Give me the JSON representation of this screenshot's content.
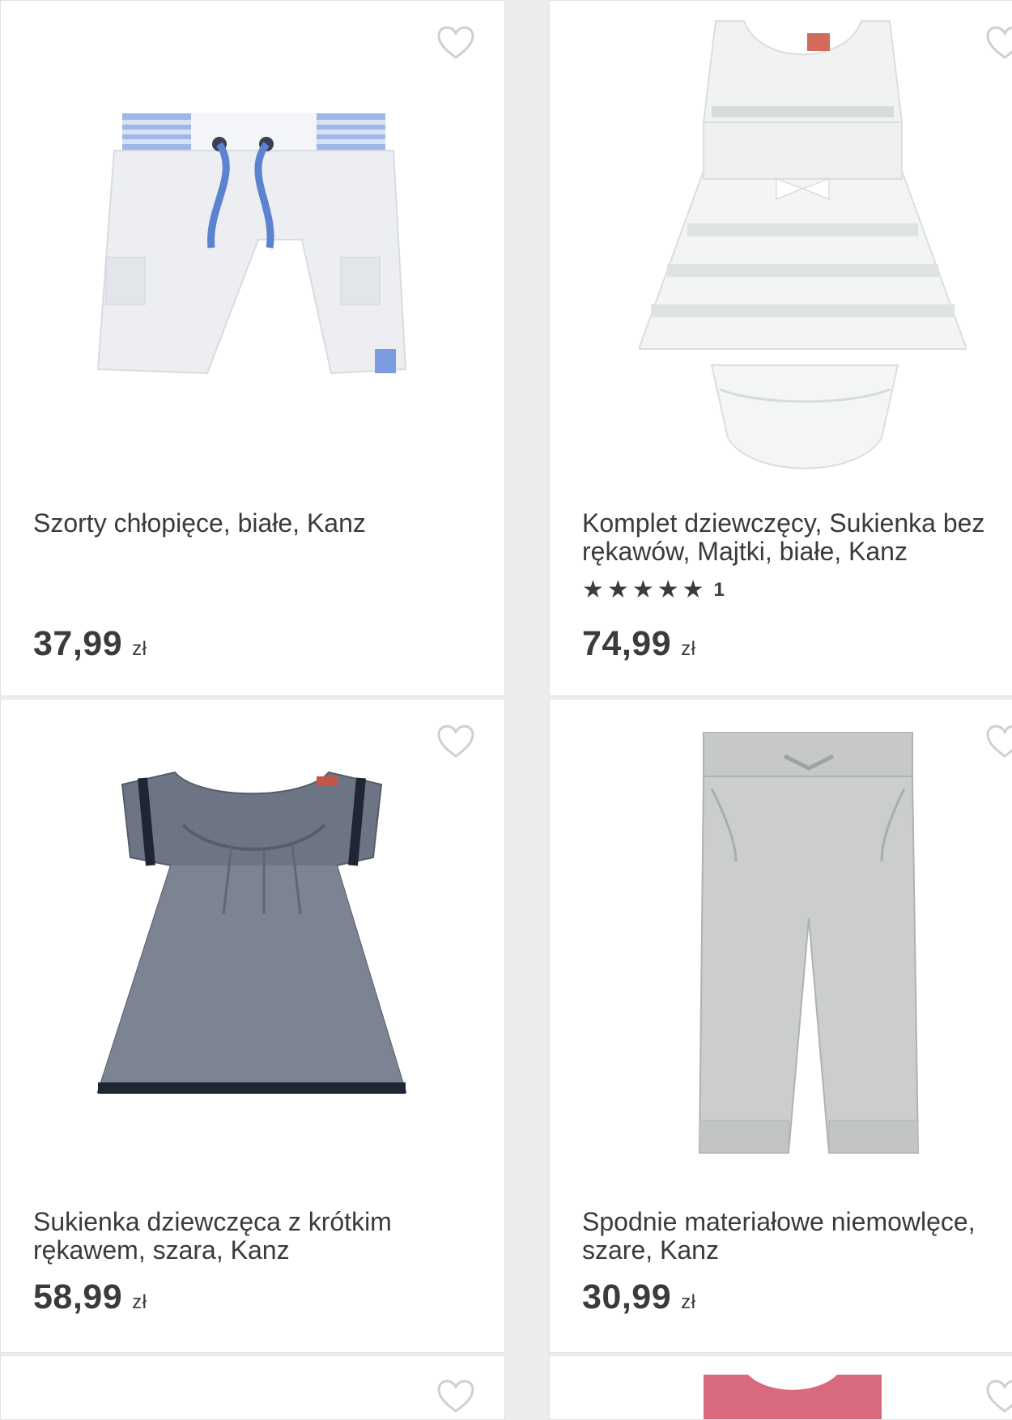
{
  "products": [
    {
      "title": "Szorty chłopięce, białe, Kanz",
      "price": "37,99",
      "currency": "zł",
      "image_icon": "shorts-image"
    },
    {
      "title": "Komplet dziewczęcy, Sukienka bez\nrękawów, Majtki, białe, Kanz",
      "price": "74,99",
      "currency": "zł",
      "rating_count": "1",
      "rating_stars": 5,
      "image_icon": "dress-set-image"
    },
    {
      "title": "Sukienka dziewczęca z krótkim\nrękawem, szara, Kanz",
      "price": "58,99",
      "currency": "zł",
      "image_icon": "dress-image"
    },
    {
      "title": "Spodnie materiałowe niemowlęce,\nszare, Kanz",
      "price": "30,99",
      "currency": "zł",
      "image_icon": "trousers-image"
    }
  ],
  "icons": {
    "favorite": "heart-outline-icon",
    "star": "star-icon"
  },
  "colors": {
    "text": "#3a3a3a",
    "background": "#ececec",
    "card": "#ffffff",
    "heart": "#cfcfcf"
  }
}
